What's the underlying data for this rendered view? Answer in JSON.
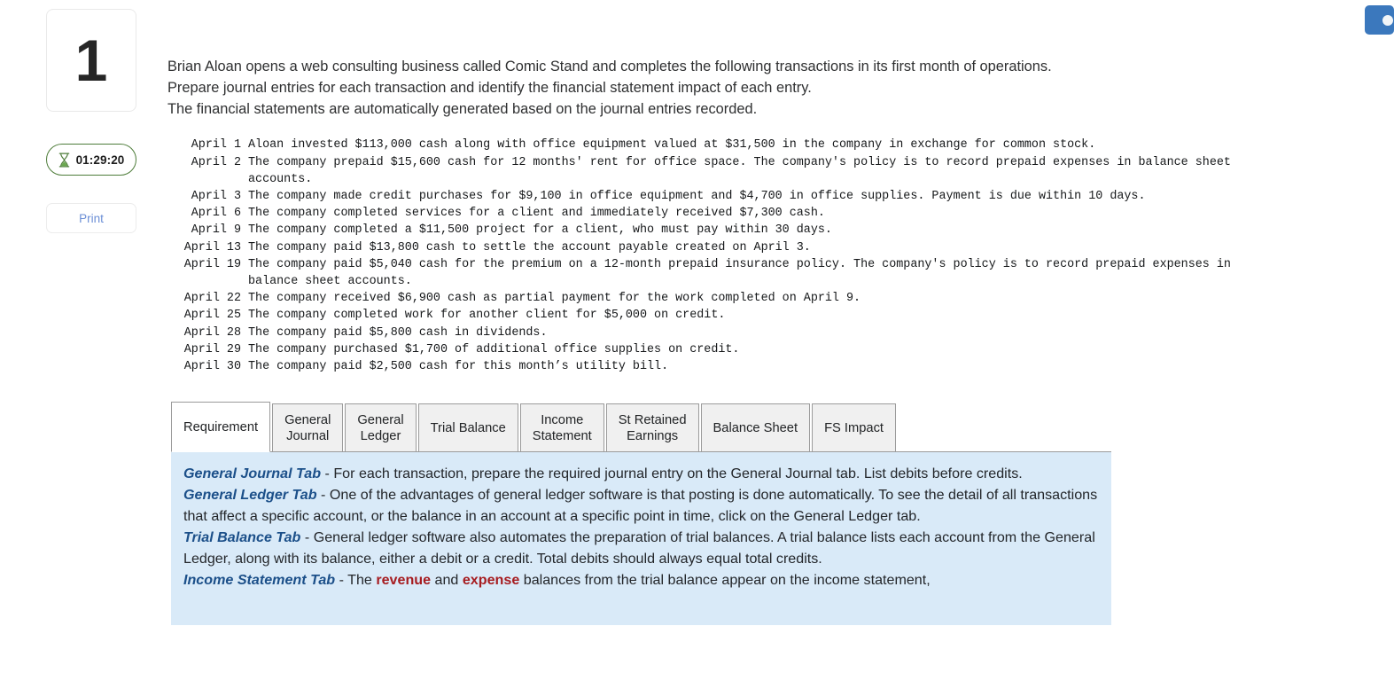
{
  "left_rail": {
    "question_number": "1",
    "timer": {
      "icon": "hourglass-icon",
      "value": "01:29:20",
      "border_color": "#4e7d3a"
    },
    "print_label": "Print"
  },
  "intro": {
    "line1": "Brian Aloan opens a web consulting business called Comic Stand and completes the following transactions in its first month of operations.",
    "line2": "Prepare journal entries for each transaction and identify the financial statement impact of each entry.",
    "line3": "The financial statements are automatically generated based on the journal entries recorded."
  },
  "transactions": [
    {
      "date": "April 1",
      "desc": "Aloan invested $113,000 cash along with office equipment valued at $31,500 in the company in exchange for common stock."
    },
    {
      "date": "April 2",
      "desc": "The company prepaid $15,600 cash for 12 months' rent for office space. The company's policy is to record prepaid expenses in balance sheet accounts."
    },
    {
      "date": "April 3",
      "desc": "The company made credit purchases for $9,100 in office equipment and $4,700 in office supplies. Payment is due within 10 days."
    },
    {
      "date": "April 6",
      "desc": "The company completed services for a client and immediately received $7,300 cash."
    },
    {
      "date": "April 9",
      "desc": "The company completed a $11,500 project for a client, who must pay within 30 days."
    },
    {
      "date": "April 13",
      "desc": "The company paid $13,800 cash to settle the account payable created on April 3."
    },
    {
      "date": "April 19",
      "desc": "The company paid $5,040 cash for the premium on a 12-month prepaid insurance policy. The company's policy is to record prepaid expenses in balance sheet accounts."
    },
    {
      "date": "April 22",
      "desc": "The company received $6,900 cash as partial payment for the work completed on April 9."
    },
    {
      "date": "April 25",
      "desc": "The company completed work for another client for $5,000 on credit."
    },
    {
      "date": "April 28",
      "desc": "The company paid $5,800 cash in dividends."
    },
    {
      "date": "April 29",
      "desc": "The company purchased $1,700 of additional office supplies on credit."
    },
    {
      "date": "April 30",
      "desc": "The company paid $2,500 cash for this month’s utility bill."
    }
  ],
  "tabs": [
    {
      "label": "Requirement",
      "active": true
    },
    {
      "label": "General\nJournal",
      "active": false
    },
    {
      "label": "General\nLedger",
      "active": false
    },
    {
      "label": "Trial Balance",
      "active": false
    },
    {
      "label": "Income\nStatement",
      "active": false
    },
    {
      "label": "St Retained\nEarnings",
      "active": false
    },
    {
      "label": "Balance Sheet",
      "active": false
    },
    {
      "label": "FS Impact",
      "active": false
    }
  ],
  "instructions": {
    "background_color": "#d9eaf8",
    "heading_color": "#1b4f89",
    "highlight_color": "#a61c20",
    "blocks": [
      {
        "name": "General Journal Tab",
        "body": " - For each transaction, prepare the required journal entry on the General Journal tab. List debits before credits."
      },
      {
        "name": "General Ledger Tab",
        "body": " - One of the advantages of general ledger software is that posting is done automatically. To see the detail of all transactions that affect a specific account, or the balance in an account at a specific point in time, click on the General Ledger tab."
      },
      {
        "name": "Trial Balance Tab",
        "body": " - General ledger software also automates the preparation of trial balances. A trial balance lists each account from the General Ledger, along with its balance, either a debit or a credit. Total debits should always equal total credits."
      },
      {
        "name": "Income Statement Tab",
        "body_pre": " - The ",
        "hl1": "revenue",
        "body_mid": " and ",
        "hl2": "expense",
        "body_post": " balances from the trial balance appear on the income statement,"
      }
    ]
  },
  "right_tab": {
    "icon": "feedback-tab-icon",
    "color": "#3b78bd"
  }
}
